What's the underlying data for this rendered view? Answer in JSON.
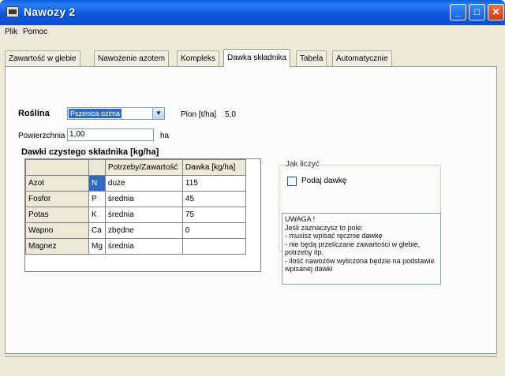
{
  "window": {
    "title": "Nawozy 2"
  },
  "menu": {
    "items": [
      "Plik",
      "Pomoc"
    ]
  },
  "tabs": [
    {
      "label": "Zawartość w glebie"
    },
    {
      "label": "Nawożenie azotem"
    },
    {
      "label": "Kompleks"
    },
    {
      "label": "Dawka składnika"
    },
    {
      "label": "Tabela"
    },
    {
      "label": "Automatycznie"
    }
  ],
  "form": {
    "roslina_label": "Roślina",
    "roslina_value": "Pszenica ozima",
    "plon_label": "Plon [t/ha]",
    "plon_value": "5,0",
    "powierzchnia_label": "Powierzchnia",
    "powierzchnia_value": "1,00",
    "powierzchnia_unit": "ha"
  },
  "grid": {
    "title": "Dawki czystego składnika [kg/ha]",
    "headers": [
      "",
      "",
      "Potrzeby/Zawartość",
      "Dawka [kg/ha]"
    ],
    "rows": [
      [
        "Azot",
        "N",
        "duże",
        "115"
      ],
      [
        "Fosfor",
        "P",
        "średnia",
        "45"
      ],
      [
        "Potas",
        "K",
        "średnia",
        "75"
      ],
      [
        "Wapno",
        "Ca",
        "zbędne",
        "0"
      ],
      [
        "Magnez",
        "Mg",
        "średnia",
        ""
      ]
    ]
  },
  "calc": {
    "group_label": "Jak liczyć",
    "checkbox_label": "Podaj dawkę",
    "memo": [
      "UWAGA !",
      "Jeśli zaznaczysz to pole:",
      "- musisz wpisać ręcznie dawkę",
      "- nie będą przeliczane zawartości w glebie, potrzeby itp.",
      "- ilość nawozów wyliczona będzie na podstawie wpisanej dawki"
    ]
  },
  "colors": {
    "titlebar": "#0a5fe0",
    "selection": "#316ac5",
    "dialog": "#ece9d8"
  }
}
